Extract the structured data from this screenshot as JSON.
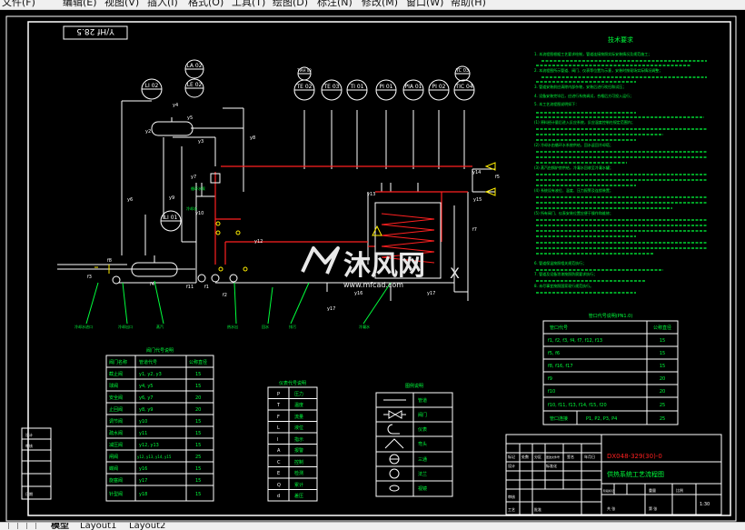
{
  "menu": {
    "items": [
      "文件(F)",
      "编辑(E)",
      "视图(V)",
      "插入(I)",
      "格式(O)",
      "工具(T)",
      "绘图(D)",
      "标注(N)",
      "修改(M)",
      "窗口(W)",
      "帮助(H)"
    ]
  },
  "drawing": {
    "stamp": "Y/Hf 28.5",
    "instruments": {
      "top_row": [
        "TE 02",
        "TE 03",
        "TI 01",
        "PI 01",
        "PIA 01",
        "PI 02",
        "TIC 04",
        "TC 03"
      ],
      "lrow2": [
        "LI 02",
        "LA 02",
        "LE 02"
      ],
      "lower": [
        "LI 01"
      ],
      "extra": [
        "TIAH 03"
      ]
    },
    "tech_requirements": {
      "title": "技术要求",
      "items": [
        "1. 本流程图根据工艺要求绘制，管道连接按照实际安装情况及规范施工；",
        "2. 本流程图所示管道、阀门、仪表等位置为示意，安装时按现场实际情况调整；",
        "3. 管道安装前应清除内部杂物，安装后进行吹扫和试压；",
        "4. 设备安装完毕后，应进行系统调试，合格后方可投入运行；",
        "5. 本工艺流程图说明如下：",
        "(1) 原料经计量后进入反应系统，反应温度控制在规定范围内；",
        "(2) 冷却水由循环水系统供给，回水返回冷却塔；",
        "(3) 蒸汽由锅炉房供给，冷凝水回收至冷凝水罐；",
        "(4) 系统设有液位、温度、压力报警及连锁装置；",
        "(5) 所有阀门、仪表安装位置应便于操作和维修；",
        "6. 管道保温按照相关规范执行；",
        "7. 管道及设备涂漆按照防腐要求执行；",
        "8. 未尽事宜按照国家现行规范执行。"
      ]
    },
    "valve_table": {
      "title": "阀门代号说明",
      "headers": [
        "阀门名称",
        "管道代号",
        "公称直径"
      ],
      "rows": [
        [
          "截止阀",
          "y1, y2, y3",
          "15"
        ],
        [
          "球阀",
          "y4, y5",
          "15"
        ],
        [
          "安全阀",
          "y6, y7",
          "20"
        ],
        [
          "止回阀",
          "y8, y9",
          "20"
        ],
        [
          "调节阀",
          "y10",
          "15"
        ],
        [
          "疏水阀",
          "y11",
          "15"
        ],
        [
          "减压阀",
          "y12, y13",
          "15"
        ],
        [
          "闸阀",
          "y12, y13, y14, y15",
          "25"
        ],
        [
          "蝶阀",
          "y16",
          "15"
        ],
        [
          "旋塞阀",
          "y17",
          "15"
        ],
        [
          "针型阀",
          "y18",
          "15"
        ]
      ]
    },
    "instrument_table": {
      "title": "仪表代号说明",
      "rows": [
        [
          "P",
          "压力"
        ],
        [
          "T",
          "温度"
        ],
        [
          "F",
          "流量"
        ],
        [
          "L",
          "液位"
        ],
        [
          "I",
          "指示"
        ],
        [
          "A",
          "报警"
        ],
        [
          "C",
          "控制"
        ],
        [
          "E",
          "检测"
        ],
        [
          "Q",
          "累计"
        ],
        [
          "d",
          "差压"
        ]
      ]
    },
    "legend_table": {
      "title": "图例说明",
      "rows": [
        "管道",
        "阀门",
        "仪表",
        "弯头",
        "三通",
        "法兰",
        "视镜"
      ]
    },
    "pipe_table": {
      "title": "管口代号说明(PN1.0)",
      "headers": [
        "管口代号",
        "公称直径"
      ],
      "rows": [
        [
          "f1, f2, f3, f4, f7, f12, f13",
          "15"
        ],
        [
          "f5, f6",
          "15"
        ],
        [
          "f8, f16, f17",
          "15"
        ],
        [
          "f9",
          "20"
        ],
        [
          "f10",
          "20"
        ],
        [
          "f10, f11, f13, f14, f15, f20",
          "25"
        ],
        [
          "管口连接",
          "P1, P2, P3, P4",
          "25"
        ]
      ]
    },
    "title_block": {
      "drawing_no": "DX048-329(30)-0",
      "drawing_name": "供热系统工艺流程图",
      "scale": "1:30",
      "labels": [
        "标记",
        "处数",
        "分区",
        "更改文件号",
        "签名",
        "年月日",
        "设计",
        "标准化",
        "审核",
        "工艺",
        "批准",
        "阶段标记",
        "重量",
        "比例",
        "共 张",
        "第 张"
      ]
    },
    "left_block": [
      "设计",
      "审核",
      "日期"
    ],
    "watermark": {
      "text": "沐风网",
      "url": "www.mfcad.com",
      "color": "#e8e8e8"
    },
    "colors": {
      "frame": "#ffffff",
      "pipe_red": "#ff2020",
      "green": "#00ff3c",
      "yellow": "#ffee00",
      "cyan": "#00ffff"
    }
  },
  "tabs": [
    "模型",
    "Layout1",
    "Layout2"
  ]
}
